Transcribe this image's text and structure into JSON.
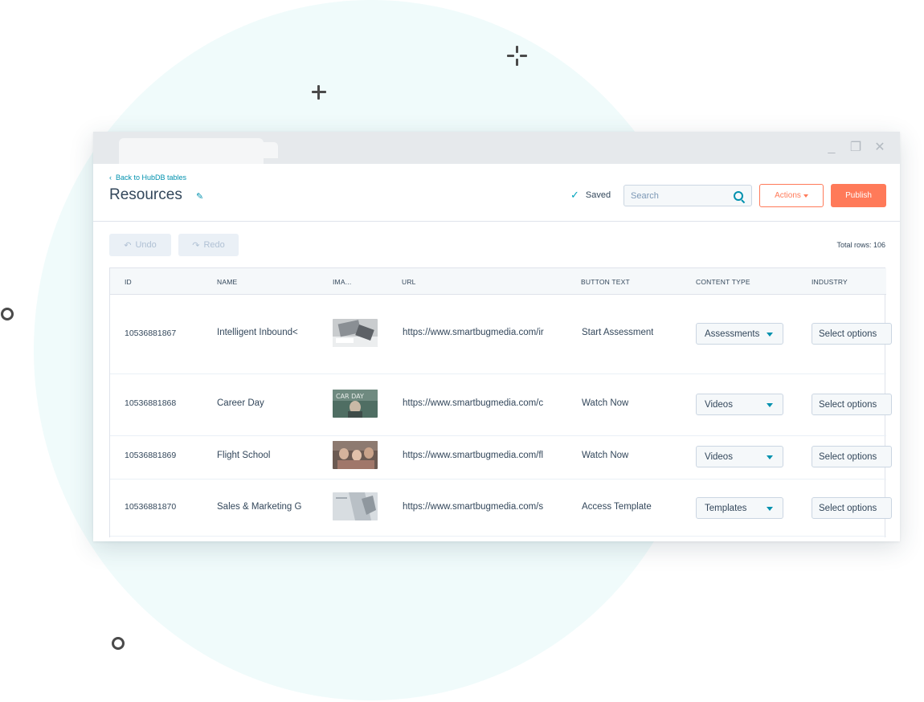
{
  "header": {
    "back_link": "Back to HubDB tables",
    "title": "Resources",
    "saved_label": "Saved",
    "search_placeholder": "Search",
    "actions_label": "Actions",
    "publish_label": "Publish"
  },
  "toolbar": {
    "undo_label": "Undo",
    "redo_label": "Redo",
    "total_rows": "Total rows: 106"
  },
  "table": {
    "columns": [
      "ID",
      "NAME",
      "IMA...",
      "URL",
      "BUTTON TEXT",
      "CONTENT TYPE",
      "INDUSTRY"
    ],
    "rows": [
      {
        "id": "10536881867",
        "name": "Intelligent Inbound<",
        "url": "https://www.smartbugmedia.com/ir",
        "button_text": "Start Assessment",
        "content_type": "Assessments",
        "industry": "Select options"
      },
      {
        "id": "10536881868",
        "name": "Career Day",
        "url": "https://www.smartbugmedia.com/c",
        "button_text": "Watch Now",
        "content_type": "Videos",
        "industry": "Select options"
      },
      {
        "id": "10536881869",
        "name": "Flight School",
        "url": "https://www.smartbugmedia.com/fl",
        "button_text": "Watch Now",
        "content_type": "Videos",
        "industry": "Select options"
      },
      {
        "id": "10536881870",
        "name": "Sales & Marketing G",
        "url": "https://www.smartbugmedia.com/s",
        "button_text": "Access Template",
        "content_type": "Templates",
        "industry": "Select options"
      }
    ]
  },
  "colors": {
    "accent": "#ff7a59",
    "link": "#0091ae",
    "text": "#33475b",
    "background_circle": "#f0fbfb"
  },
  "icons": [
    "chevron-left-icon",
    "pencil-icon",
    "check-icon",
    "search-icon",
    "caret-down-icon",
    "undo-icon",
    "redo-icon",
    "close-icon",
    "minimize-icon",
    "maximize-icon"
  ]
}
